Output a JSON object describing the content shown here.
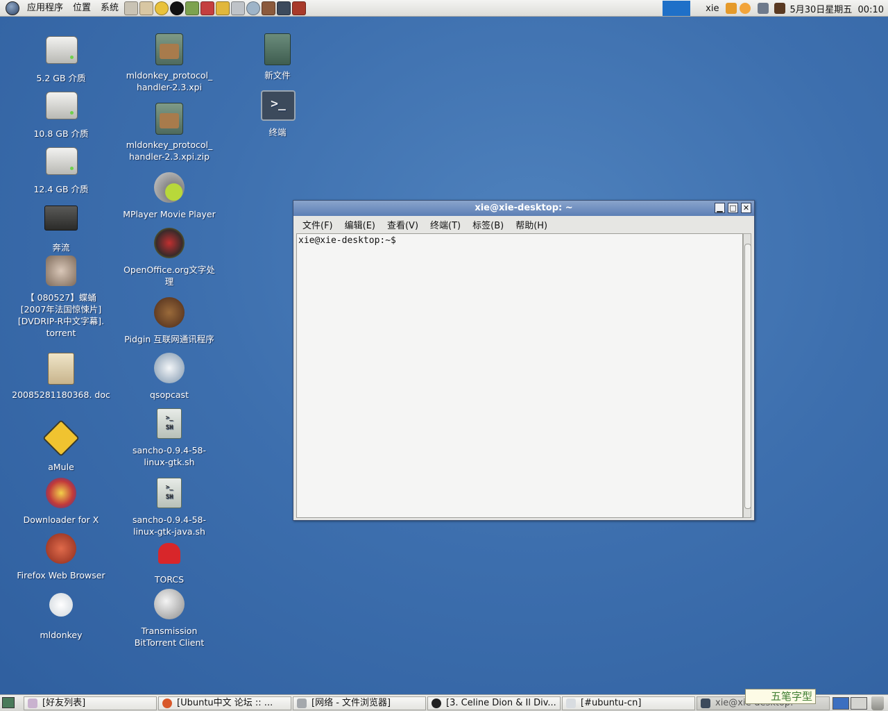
{
  "top_panel": {
    "menus": [
      "应用程序",
      "位置",
      "系统"
    ],
    "user": "xie",
    "clock": "5月30日星期五  00:10"
  },
  "desktop": {
    "col1": [
      "5.2 GB 介质",
      "10.8 GB 介质",
      "12.4 GB 介质",
      "奔流",
      "【 080527】蝶蛹 [2007年法国惊悚片] [DVDRIP-R中文字幕]. torrent",
      "20085281180368. doc",
      "aMule",
      "Downloader for X",
      "Firefox Web Browser",
      "mldonkey"
    ],
    "col2": [
      "mldonkey_protocol_ handler-2.3.xpi",
      "mldonkey_protocol_ handler-2.3.xpi.zip",
      "MPlayer Movie Player",
      "OpenOffice.org文字处 理",
      "Pidgin 互联网通讯程序",
      "qsopcast",
      "sancho-0.9.4-58- linux-gtk.sh",
      "sancho-0.9.4-58- linux-gtk-java.sh",
      "TORCS",
      "Transmission BitTorrent Client"
    ],
    "col3": [
      "新文件",
      "终端"
    ]
  },
  "terminal": {
    "title": "xie@xie-desktop: ~",
    "menus": [
      "文件(F)",
      "编辑(E)",
      "查看(V)",
      "终端(T)",
      "标签(B)",
      "帮助(H)"
    ],
    "prompt": "xie@xie-desktop:~$",
    "buttons": {
      "minimize": "▁",
      "maximize": "□",
      "close": "✕"
    }
  },
  "taskbar": {
    "items": [
      "[好友列表]",
      "[Ubuntu中文 论坛 :: ...",
      "[网络 - 文件浏览器]",
      "[3. Celine Dion & Il Div...",
      "[#ubuntu-cn]",
      "xie@xie-desktop: ~"
    ],
    "ime": "五笔字型"
  },
  "colors": {
    "desktop_bg": "#3d6fae",
    "titlebar": "#5c7fb5",
    "panel": "#dcdcd8"
  }
}
